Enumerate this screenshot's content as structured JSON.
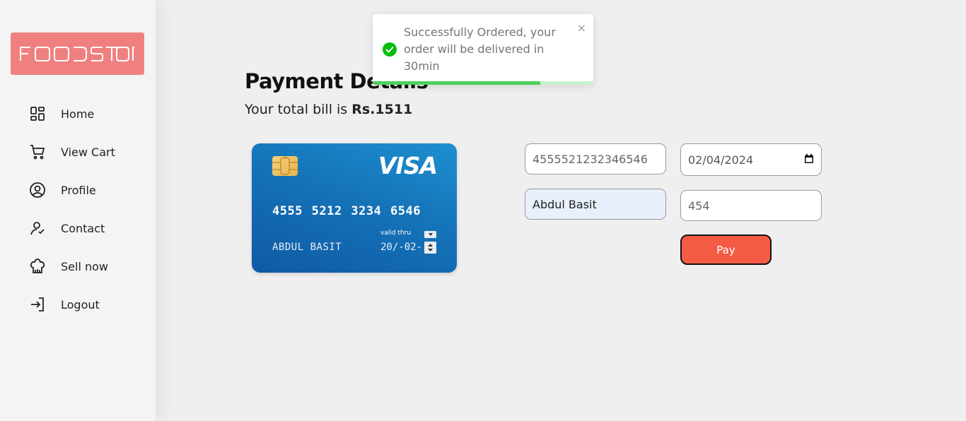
{
  "app": {
    "logo_text": "FOODSTOP",
    "brand_color": "#f08080"
  },
  "sidebar": {
    "items": [
      {
        "label": "Home",
        "icon": "dashboard-icon"
      },
      {
        "label": "View Cart",
        "icon": "cart-icon"
      },
      {
        "label": "Profile",
        "icon": "user-circle-icon"
      },
      {
        "label": "Contact",
        "icon": "contact-icon"
      },
      {
        "label": "Sell now",
        "icon": "chef-hat-icon"
      },
      {
        "label": "Logout",
        "icon": "logout-icon"
      }
    ]
  },
  "main": {
    "title": "Payment Details",
    "bill_prefix": "Your total bill is ",
    "bill_amount": "Rs.1511"
  },
  "card": {
    "brand": "VISA",
    "number": "4555 5212 3234 6546",
    "holder": "ABDUL BASIT",
    "valid_thru_label": "valid thru",
    "expiry": "20/-02-"
  },
  "form": {
    "card_number_value": "4555521232346546",
    "name_value": "Abdul Basit",
    "date_value": "02/04/2024",
    "cvv_value": "454",
    "pay_label": "Pay",
    "pay_color": "#f55a45"
  },
  "toast": {
    "message": "Successfully Ordered, your order will be delivered in 30min",
    "close_glyph": "×",
    "progress": 0.76,
    "success_color": "#07bc0c"
  }
}
